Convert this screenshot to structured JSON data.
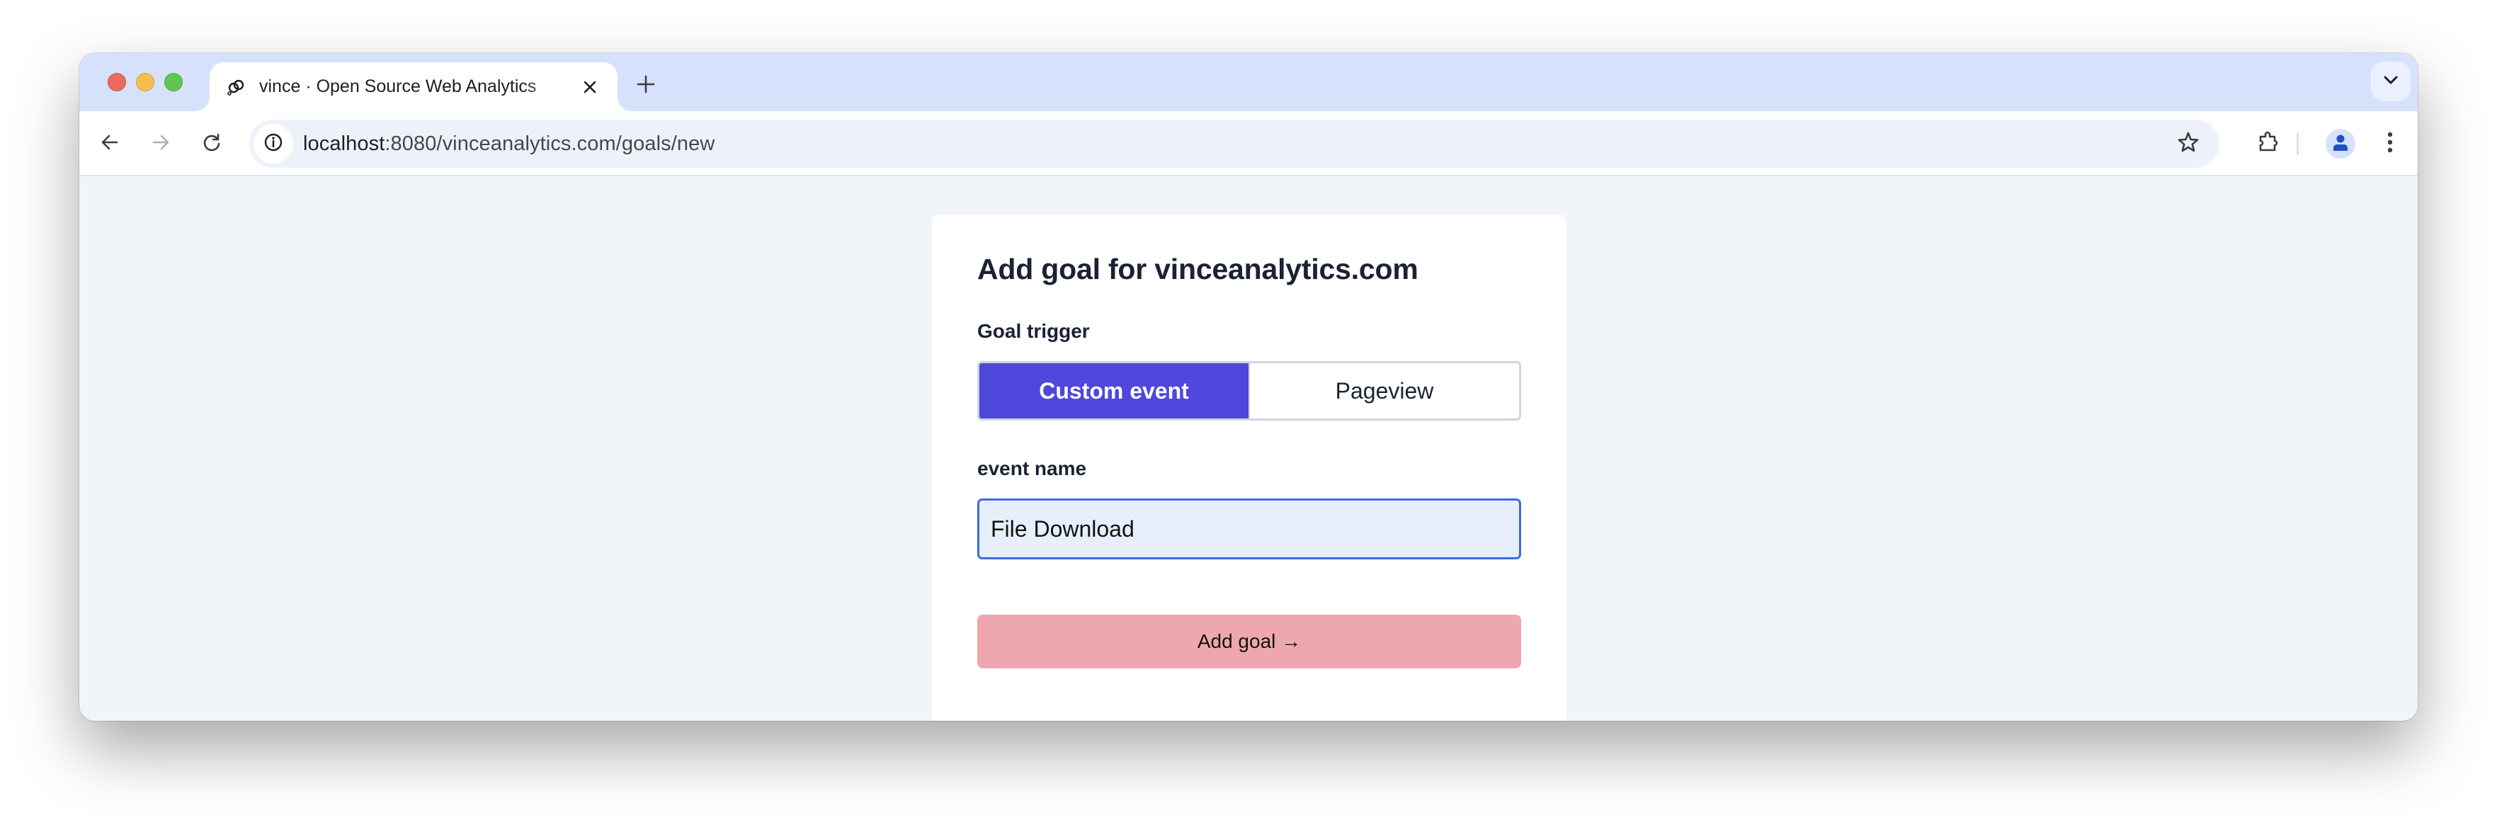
{
  "browser": {
    "tab": {
      "title": "vince · Open Source Web Analytics",
      "favicon": "vince-logo-icon",
      "close_icon": "close-icon"
    },
    "new_tab_icon": "plus-icon",
    "tab_search_icon": "chevron-down-icon",
    "toolbar": {
      "back_icon": "arrow-left-icon",
      "forward_icon": "arrow-right-icon",
      "reload_icon": "reload-icon",
      "site_info_icon": "info-icon",
      "url_host": "localhost",
      "url_rest": ":8080/vinceanalytics.com/goals/new",
      "bookmark_icon": "star-icon",
      "extensions_icon": "puzzle-icon",
      "profile_icon": "person-icon",
      "menu_icon": "kebab-menu-icon"
    }
  },
  "page": {
    "title": "Add goal for vinceanalytics.com",
    "goal_trigger": {
      "label": "Goal trigger",
      "options": [
        {
          "label": "Custom event",
          "selected": true
        },
        {
          "label": "Pageview",
          "selected": false
        }
      ]
    },
    "event_name": {
      "label": "event name",
      "value": "File Download"
    },
    "submit_label": "Add goal →",
    "colors": {
      "accent": "#4f46db",
      "submit_bg": "#eea7ae",
      "input_focus_border": "#3d6be0",
      "input_bg": "#e8effc",
      "page_bg": "#f1f4f9"
    }
  }
}
